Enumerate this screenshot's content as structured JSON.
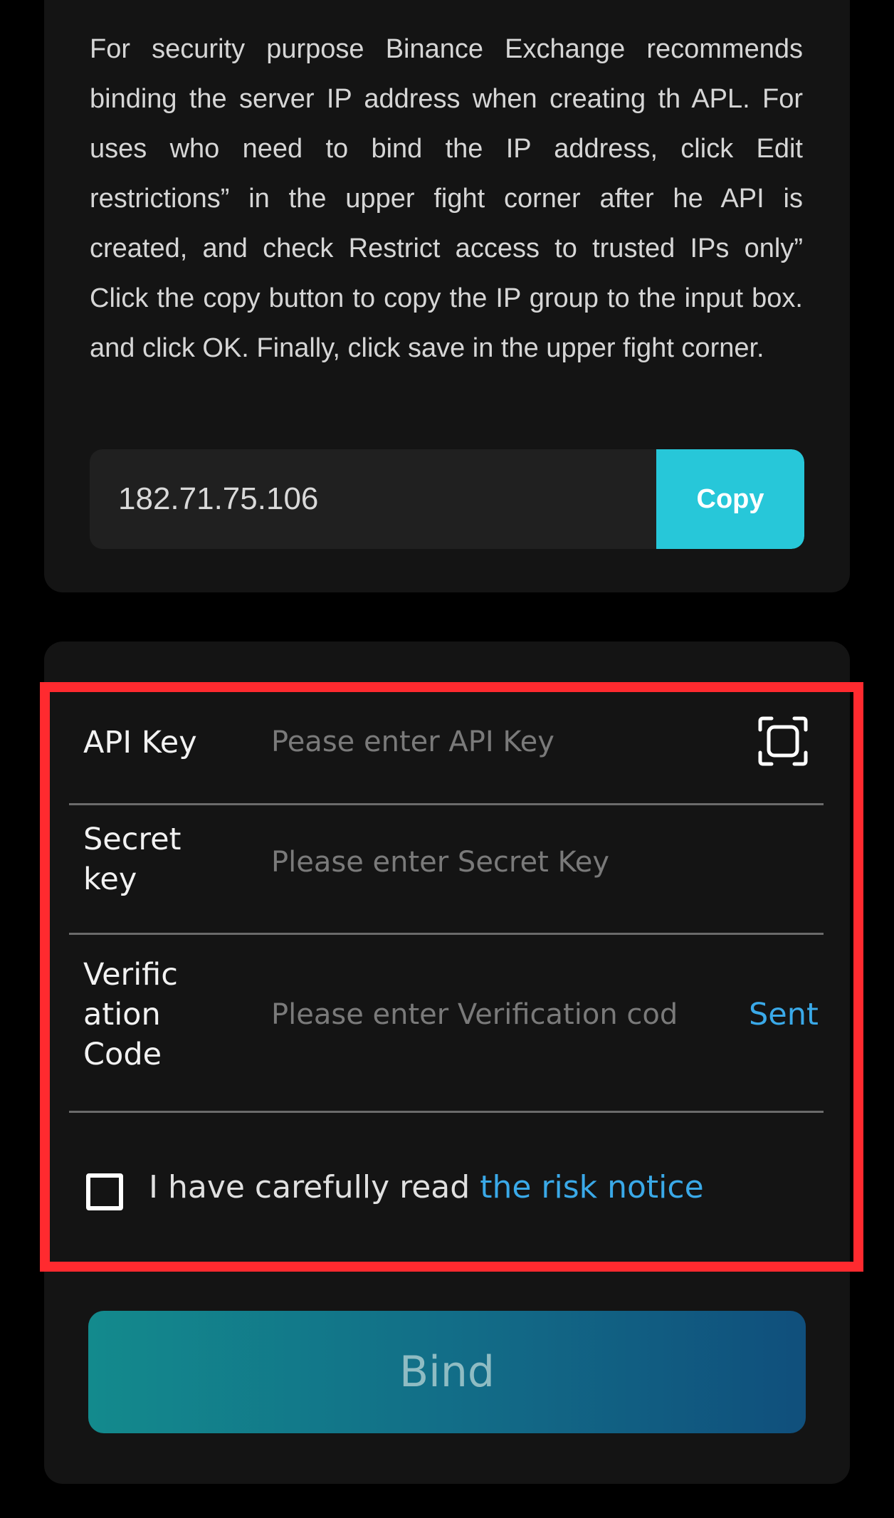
{
  "security_notice": {
    "text": "For security purpose Binance Exchange recommends binding the server IP address when creating th APL. For uses who need to bind the IP address, click Edit restrictions” in the upper fight corner after he API is created, and check Restrict access to trusted IPs only” Click the copy button to copy the IP group to the input box. and click OK. Finally, click save in the upper fight corner."
  },
  "ip_group": {
    "value": "182.71.75.106",
    "copy_label": "Copy"
  },
  "form": {
    "api_key": {
      "label": "API Key",
      "placeholder": "Pease enter API Key",
      "value": "",
      "scan_icon": "scan-icon"
    },
    "secret_key": {
      "label": "Secret key",
      "placeholder": "Please enter Secret Key",
      "value": ""
    },
    "verification_code": {
      "label": "Verification Code",
      "placeholder": "Please enter Verification code",
      "value": "",
      "send_label": "Sent"
    },
    "agreement": {
      "checked": false,
      "text": "I have carefully read ",
      "link_text": "the risk notice"
    }
  },
  "bind_button": {
    "label": "Bind"
  },
  "colors": {
    "background": "#000000",
    "card": "#141414",
    "accent_copy": "#27c7d9",
    "link": "#3aa9e8",
    "highlight_border": "#ff2a2f",
    "bind_gradient_start": "#138a8d",
    "bind_gradient_end": "#104f7c"
  }
}
